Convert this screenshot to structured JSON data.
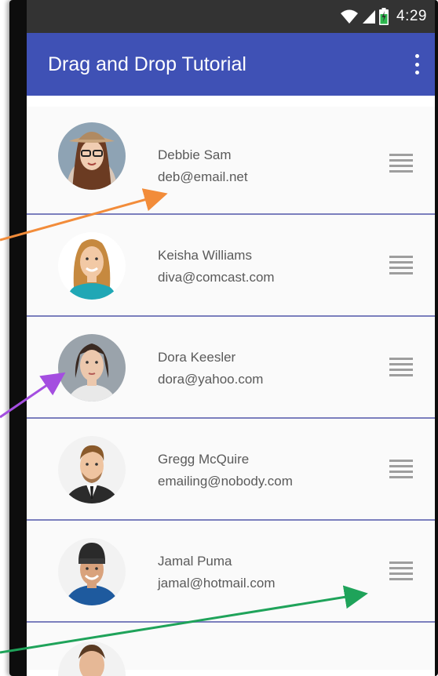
{
  "status_bar": {
    "time": "4:29"
  },
  "app_bar": {
    "title": "Drag and Drop Tutorial",
    "menu_icon": "more-vert-icon"
  },
  "contacts": [
    {
      "name": "Debbie Sam",
      "email": "deb@email.net"
    },
    {
      "name": "Keisha Williams",
      "email": "diva@comcast.com"
    },
    {
      "name": "Dora Keesler",
      "email": "dora@yahoo.com"
    },
    {
      "name": "Gregg McQuire",
      "email": "emailing@nobody.com"
    },
    {
      "name": "Jamal Puma",
      "email": "jamal@hotmail.com"
    }
  ],
  "handle_icon": "drag-handle-icon",
  "colors": {
    "app_bar": "#3f51b5",
    "divider": "#7b7fbd",
    "arrow_orange": "#f28c3a",
    "arrow_purple": "#a44ee0",
    "arrow_green": "#1fa35a"
  }
}
